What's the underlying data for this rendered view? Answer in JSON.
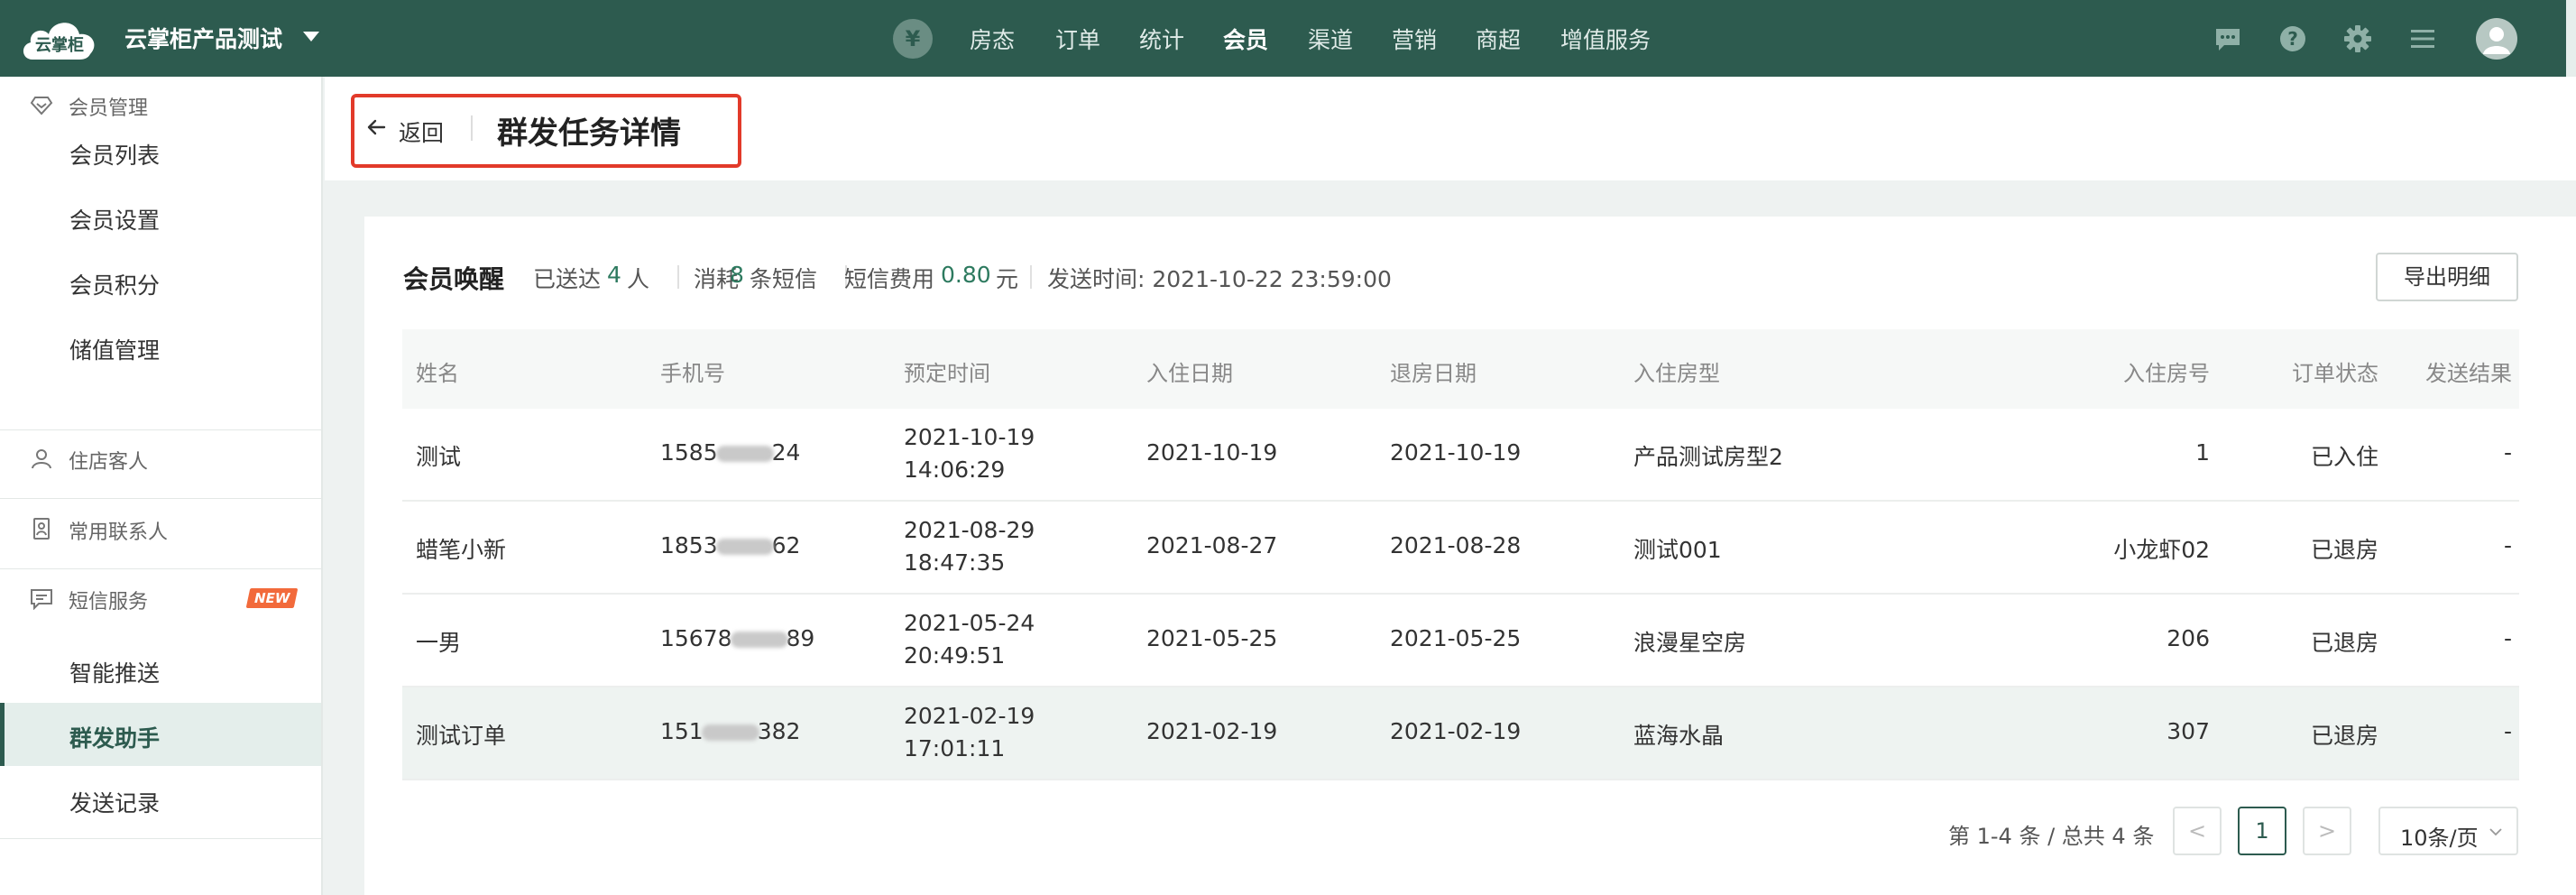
{
  "app": {
    "logo_text": "云掌柜",
    "product_name": "云掌柜产品测试"
  },
  "nav": {
    "yen_icon_label": "¥",
    "items": [
      "房态",
      "订单",
      "统计",
      "会员",
      "渠道",
      "营销",
      "商超",
      "增值服务"
    ],
    "active": "会员",
    "right_icons": [
      "chat-icon",
      "help-icon",
      "gear-icon",
      "menu-icon",
      "avatar-icon"
    ]
  },
  "sidebar": {
    "member": {
      "title": "会员管理",
      "icon": "gem-icon",
      "items": [
        "会员列表",
        "会员设置",
        "会员积分",
        "储值管理"
      ]
    },
    "guest": {
      "title": "住店客人",
      "icon": "person-icon"
    },
    "contact": {
      "title": "常用联系人",
      "icon": "contact-card-icon"
    },
    "sms": {
      "title": "短信服务",
      "icon": "message-icon",
      "badge": "NEW",
      "items": [
        "智能推送",
        "群发助手",
        "发送记录"
      ],
      "active": "群发助手"
    }
  },
  "header": {
    "back_label": "返回",
    "title": "群发任务详情"
  },
  "summary": {
    "task_name": "会员唤醒",
    "delivered_prefix": "已送达",
    "delivered_count": "4",
    "delivered_unit": "人",
    "consumed_prefix": "消耗",
    "consumed_count": "8",
    "consumed_unit": "条短信",
    "fee_prefix": "短信费用",
    "fee_value": "0.80",
    "fee_unit": "元",
    "send_time": "发送时间: 2021-10-22 23:59:00",
    "export_label": "导出明细"
  },
  "table": {
    "columns": [
      "姓名",
      "手机号",
      "预定时间",
      "入住日期",
      "退房日期",
      "入住房型",
      "入住房号",
      "订单状态",
      "发送结果"
    ],
    "rows": [
      {
        "name": "测试",
        "phone_start": "1585",
        "phone_end": "24",
        "booking_date": "2021-10-19",
        "booking_time": "14:06:29",
        "checkin": "2021-10-19",
        "checkout": "2021-10-19",
        "room_type": "产品测试房型2",
        "room_no": "1",
        "status": "已入住",
        "result": "-"
      },
      {
        "name": "蜡笔小新",
        "phone_start": "1853",
        "phone_end": "62",
        "booking_date": "2021-08-29",
        "booking_time": "18:47:35",
        "checkin": "2021-08-27",
        "checkout": "2021-08-28",
        "room_type": "测试001",
        "room_no": "小龙虾02",
        "status": "已退房",
        "result": "-"
      },
      {
        "name": "一男",
        "phone_start": "15678",
        "phone_end": "89",
        "booking_date": "2021-05-24",
        "booking_time": "20:49:51",
        "checkin": "2021-05-25",
        "checkout": "2021-05-25",
        "room_type": "浪漫星空房",
        "room_no": "206",
        "status": "已退房",
        "result": "-"
      },
      {
        "name": "测试订单",
        "phone_start": "151",
        "phone_end": "382",
        "booking_date": "2021-02-19",
        "booking_time": "17:01:11",
        "checkin": "2021-02-19",
        "checkout": "2021-02-19",
        "room_type": "蓝海水晶",
        "room_no": "307",
        "status": "已退房",
        "result": "-"
      }
    ]
  },
  "pagination": {
    "total_text": "第 1-4 条 / 总共 4 条",
    "prev": "<",
    "current": "1",
    "next": ">",
    "page_size": "10条/页"
  },
  "colors": {
    "brand": "#2d5b4f",
    "accent": "#2d7a5f",
    "highlight": "#e23a2a",
    "badge": "#f26a3b"
  }
}
